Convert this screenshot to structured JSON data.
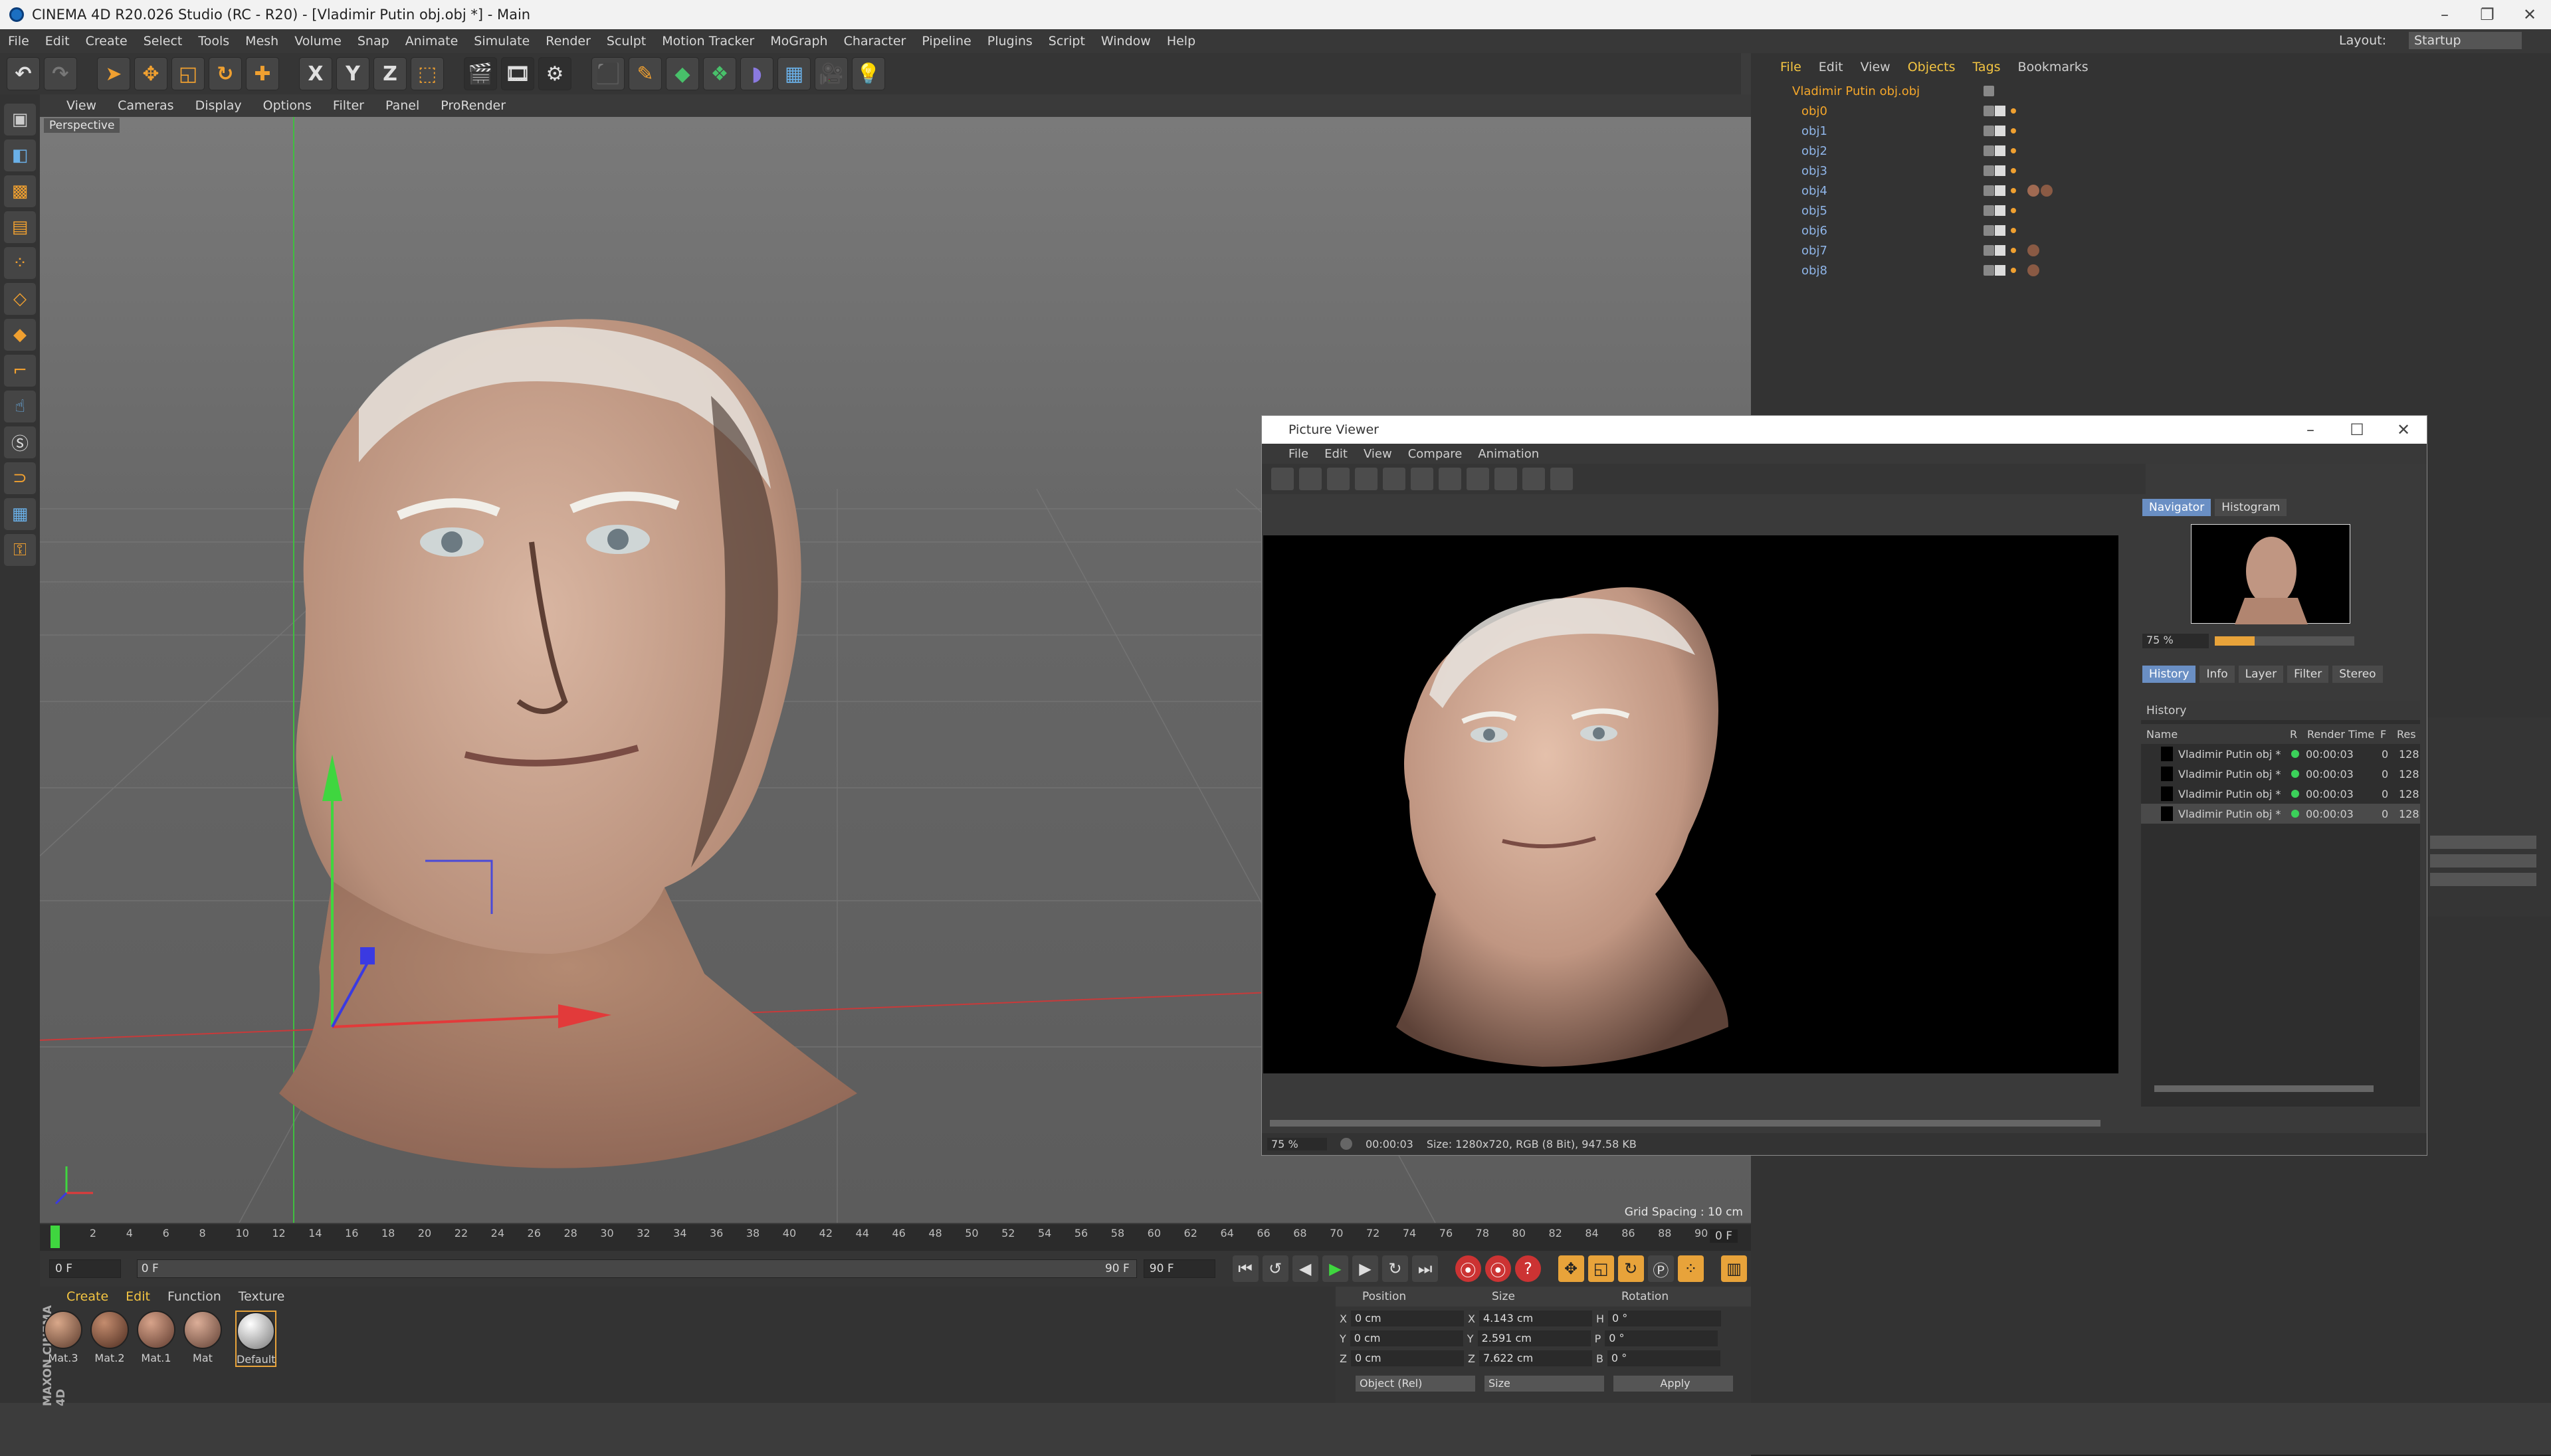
{
  "app": {
    "title": "CINEMA 4D R20.026 Studio (RC - R20) - [Vladimir Putin obj.obj *] - Main"
  },
  "menu": [
    "File",
    "Edit",
    "Create",
    "Select",
    "Tools",
    "Mesh",
    "Volume",
    "Snap",
    "Animate",
    "Simulate",
    "Render",
    "Sculpt",
    "Motion Tracker",
    "MoGraph",
    "Character",
    "Pipeline",
    "Plugins",
    "Script",
    "Window",
    "Help"
  ],
  "layout": {
    "label": "Layout:",
    "value": "Startup"
  },
  "toolbar": {
    "x": "X",
    "y": "Y",
    "z": "Z"
  },
  "viewport": {
    "menu": [
      "View",
      "Cameras",
      "Display",
      "Options",
      "Filter",
      "Panel",
      "ProRender"
    ],
    "camera": "Perspective",
    "grid": "Grid Spacing : 10 cm"
  },
  "timeline": {
    "ticks": [
      "0",
      "2",
      "4",
      "6",
      "8",
      "10",
      "12",
      "14",
      "16",
      "18",
      "20",
      "22",
      "24",
      "26",
      "28",
      "30",
      "32",
      "34",
      "36",
      "38",
      "40",
      "42",
      "44",
      "46",
      "48",
      "50",
      "52",
      "54",
      "56",
      "58",
      "60",
      "62",
      "64",
      "66",
      "68",
      "70",
      "72",
      "74",
      "76",
      "78",
      "80",
      "82",
      "84",
      "86",
      "88",
      "90"
    ],
    "frame": "0 F",
    "start": "0 F",
    "slider": "0 F",
    "end_slider": "90 F",
    "end": "90 F",
    "current": "0 F"
  },
  "materials": {
    "menu": [
      "Create",
      "Edit",
      "Function",
      "Texture"
    ],
    "items": [
      "Mat.3",
      "Mat.2",
      "Mat.1",
      "Mat",
      "Default"
    ],
    "brand": "MAXON CINEMA 4D"
  },
  "coordinates": {
    "headers": [
      "Position",
      "Size",
      "Rotation"
    ],
    "rows": [
      {
        "axis": "X",
        "pos": "0 cm",
        "size": "4.143 cm",
        "raxis": "H",
        "rot": "0 °"
      },
      {
        "axis": "Y",
        "pos": "0 cm",
        "size": "2.591 cm",
        "raxis": "P",
        "rot": "0 °"
      },
      {
        "axis": "Z",
        "pos": "0 cm",
        "size": "7.622 cm",
        "raxis": "B",
        "rot": "0 °"
      }
    ],
    "mode": "Object (Rel)",
    "size_mode": "Size",
    "apply": "Apply"
  },
  "objects": {
    "menu": [
      "File",
      "Edit",
      "View",
      "Objects",
      "Tags",
      "Bookmarks"
    ],
    "root": "Vladimir Putin obj.obj",
    "items": [
      "obj0",
      "obj1",
      "obj2",
      "obj3",
      "obj4",
      "obj5",
      "obj6",
      "obj7",
      "obj8"
    ]
  },
  "picture_viewer": {
    "title": "Picture Viewer",
    "menu": [
      "File",
      "Edit",
      "View",
      "Compare",
      "Animation"
    ],
    "nav_tabs": [
      "Navigator",
      "Histogram"
    ],
    "zoom": "75 %",
    "hist_tabs": [
      "History",
      "Info",
      "Layer",
      "Filter",
      "Stereo"
    ],
    "history_label": "History",
    "columns": [
      "Name",
      "R",
      "Render Time",
      "F",
      "Res"
    ],
    "rows": [
      {
        "name": "Vladimir Putin obj *",
        "time": "00:00:03",
        "f": "0",
        "res": "128"
      },
      {
        "name": "Vladimir Putin obj *",
        "time": "00:00:03",
        "f": "0",
        "res": "128"
      },
      {
        "name": "Vladimir Putin obj *",
        "time": "00:00:03",
        "f": "0",
        "res": "128"
      },
      {
        "name": "Vladimir Putin obj *",
        "time": "00:00:03",
        "f": "0",
        "res": "128"
      }
    ],
    "status_zoom": "75 %",
    "status_time": "00:00:03",
    "status_size": "Size: 1280x720, RGB (8 Bit), 947.58 KB"
  }
}
